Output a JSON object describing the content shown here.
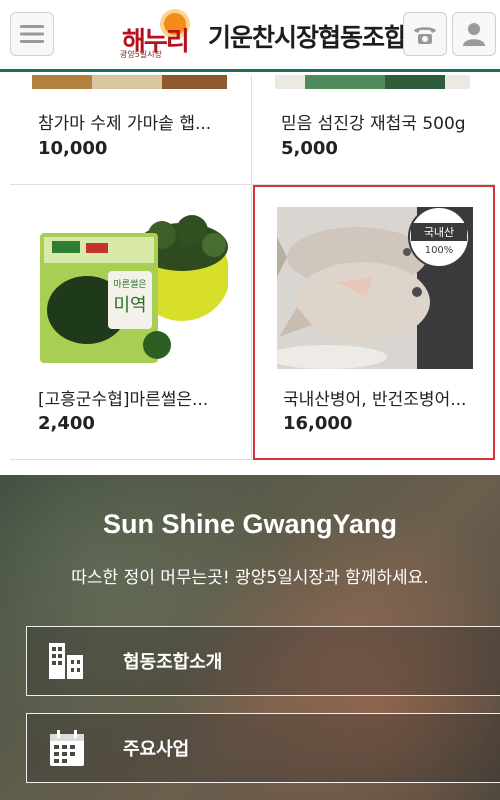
{
  "header": {
    "logo_word": "해누리",
    "logo_sub": "광양5일시장",
    "title": "기운찬시장협동조합",
    "menu_icon": "hamburger-icon",
    "phone_icon": "phone-icon",
    "user_icon": "user-icon"
  },
  "products_top": [
    {
      "name": "참가마 수제 가마솥 햅...",
      "price": "10,000"
    },
    {
      "name": "믿음 섬진강 재첩국 500g",
      "price": "5,000"
    }
  ],
  "products": [
    {
      "name": "[고흥군수협]마른썰은...",
      "price": "2,400",
      "package_text": "미역",
      "package_sub": "마른썰은"
    },
    {
      "name": "국내산병어, 반건조병어...",
      "price": "16,000",
      "badge": "국내산",
      "badge_pct": "100%",
      "selected": true
    }
  ],
  "hero": {
    "title": "Sun Shine GwangYang",
    "subtitle": "따스한 정이 머무는곳! 광양5일시장과 함께하세요.",
    "buttons": [
      {
        "label": "협동조합소개",
        "icon": "building-icon"
      },
      {
        "label": "주요사업",
        "icon": "calendar-icon"
      }
    ]
  },
  "colors": {
    "header_border": "#1f6f5c",
    "selected_border": "#d7333a",
    "logo_red": "#b5121b",
    "sun_orange": "#f28c1a"
  }
}
